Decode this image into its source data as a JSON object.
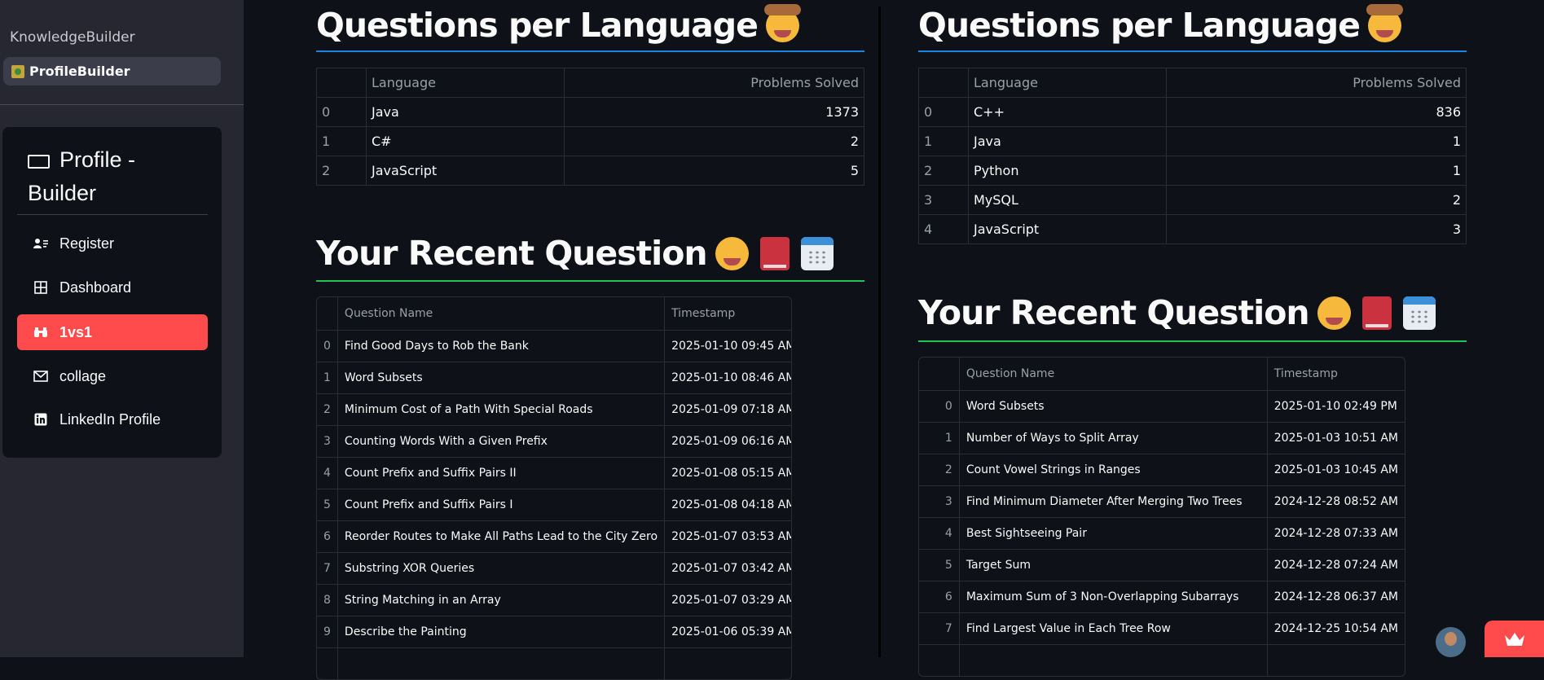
{
  "sidebar": {
    "app_name": "KnowledgeBuilder",
    "current_page": "ProfileBuilder",
    "menu_title": "Profile - Builder",
    "items": [
      {
        "label": "Register"
      },
      {
        "label": "Dashboard"
      },
      {
        "label": "1vs1"
      },
      {
        "label": "collage"
      },
      {
        "label": "LinkedIn Profile"
      }
    ],
    "active_color": "#ff4b4b"
  },
  "left": {
    "lang_title": "Questions per Language",
    "lang_headers": {
      "language": "Language",
      "solved": "Problems Solved"
    },
    "langs": [
      {
        "idx": "0",
        "language": "Java",
        "solved": "1373"
      },
      {
        "idx": "1",
        "language": "C#",
        "solved": "2"
      },
      {
        "idx": "2",
        "language": "JavaScript",
        "solved": "5"
      }
    ],
    "recent_title": "Your Recent Question",
    "recent_headers": {
      "name": "Question Name",
      "ts": "Timestamp"
    },
    "recent": [
      {
        "idx": "0",
        "name": "Find Good Days to Rob the Bank",
        "ts": "2025-01-10 09:45 AM"
      },
      {
        "idx": "1",
        "name": "Word Subsets",
        "ts": "2025-01-10 08:46 AM"
      },
      {
        "idx": "2",
        "name": "Minimum Cost of a Path With Special Roads",
        "ts": "2025-01-09 07:18 AM"
      },
      {
        "idx": "3",
        "name": "Counting Words With a Given Prefix",
        "ts": "2025-01-09 06:16 AM"
      },
      {
        "idx": "4",
        "name": "Count Prefix and Suffix Pairs II",
        "ts": "2025-01-08 05:15 AM"
      },
      {
        "idx": "5",
        "name": "Count Prefix and Suffix Pairs I",
        "ts": "2025-01-08 04:18 AM"
      },
      {
        "idx": "6",
        "name": "Reorder Routes to Make All Paths Lead to the City Zero",
        "ts": "2025-01-07 03:53 AM"
      },
      {
        "idx": "7",
        "name": "Substring XOR Queries",
        "ts": "2025-01-07 03:42 AM"
      },
      {
        "idx": "8",
        "name": "String Matching in an Array",
        "ts": "2025-01-07 03:29 AM"
      },
      {
        "idx": "9",
        "name": "Describe the Painting",
        "ts": "2025-01-06 05:39 AM"
      }
    ]
  },
  "right": {
    "lang_title": "Questions per Language",
    "lang_headers": {
      "language": "Language",
      "solved": "Problems Solved"
    },
    "langs": [
      {
        "idx": "0",
        "language": "C++",
        "solved": "836"
      },
      {
        "idx": "1",
        "language": "Java",
        "solved": "1"
      },
      {
        "idx": "2",
        "language": "Python",
        "solved": "1"
      },
      {
        "idx": "3",
        "language": "MySQL",
        "solved": "2"
      },
      {
        "idx": "4",
        "language": "JavaScript",
        "solved": "3"
      }
    ],
    "recent_title": "Your Recent Question",
    "recent_headers": {
      "name": "Question Name",
      "ts": "Timestamp"
    },
    "recent": [
      {
        "idx": "0",
        "name": "Word Subsets",
        "ts": "2025-01-10 02:49 PM"
      },
      {
        "idx": "1",
        "name": "Number of Ways to Split Array",
        "ts": "2025-01-03 10:51 AM"
      },
      {
        "idx": "2",
        "name": "Count Vowel Strings in Ranges",
        "ts": "2025-01-03 10:45 AM"
      },
      {
        "idx": "3",
        "name": "Find Minimum Diameter After Merging Two Trees",
        "ts": "2024-12-28 08:52 AM"
      },
      {
        "idx": "4",
        "name": "Best Sightseeing Pair",
        "ts": "2024-12-28 07:33 AM"
      },
      {
        "idx": "5",
        "name": "Target Sum",
        "ts": "2024-12-28 07:24 AM"
      },
      {
        "idx": "6",
        "name": "Maximum Sum of 3 Non-Overlapping Subarrays",
        "ts": "2024-12-28 06:37 AM"
      },
      {
        "idx": "7",
        "name": "Find Largest Value in Each Tree Row",
        "ts": "2024-12-25 10:54 AM"
      }
    ]
  },
  "colors": {
    "lang_underline": "#1c83e1",
    "recent_underline": "#21c354"
  },
  "icons": [
    "tv-icon",
    "register-icon",
    "dashboard-icon",
    "binoculars-icon",
    "envelope-icon",
    "linkedin-icon",
    "cowboy-face-icon",
    "smile-icon",
    "book-icon",
    "calendar-icon",
    "crown-icon"
  ]
}
